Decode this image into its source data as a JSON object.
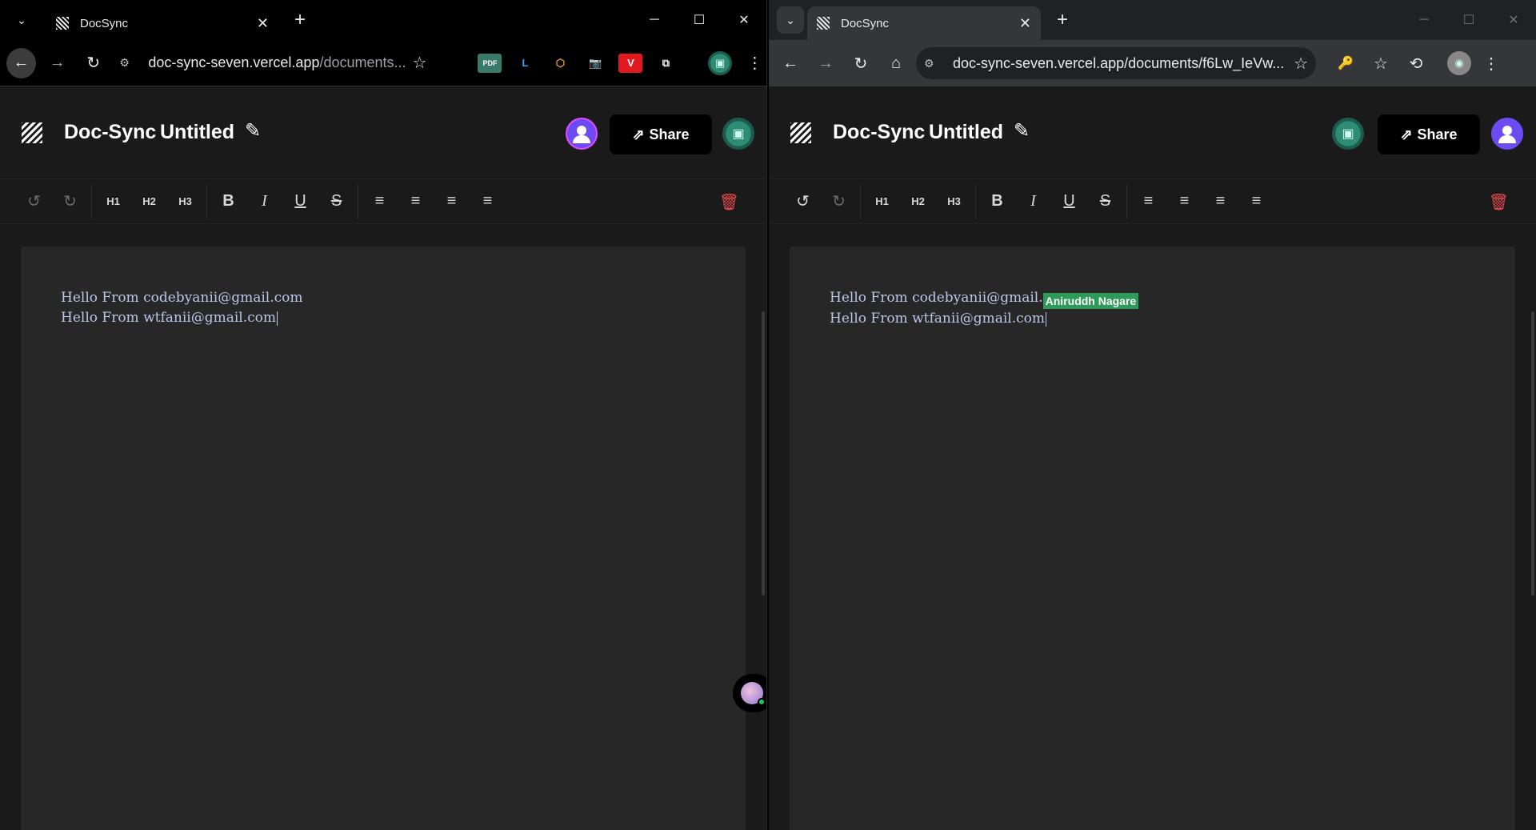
{
  "left_window": {
    "tab": {
      "title": "DocSync",
      "close": "✕"
    },
    "new_tab": "+",
    "controls": {
      "minimize": "─",
      "maximize": "☐",
      "close": "✕"
    },
    "nav": {
      "back": "←",
      "forward": "→",
      "reload": "↻"
    },
    "omnibox": {
      "host": "doc-sync-seven.vercel.app",
      "path": "/documents..."
    },
    "extensions": [
      {
        "name": "pdf-extension-icon",
        "text": "PDF",
        "bg": "#3a7a6a",
        "fg": "#ffffff"
      },
      {
        "name": "l-extension-icon",
        "text": "L",
        "bg": "transparent",
        "fg": "#2aa7ff"
      },
      {
        "name": "code-extension-icon",
        "text": "⬡",
        "bg": "transparent",
        "fg": "#f0a030"
      },
      {
        "name": "camera-extension-icon",
        "text": "📷",
        "bg": "transparent",
        "fg": "#dddddd"
      },
      {
        "name": "v-extension-icon",
        "text": "V",
        "bg": "#e0191e",
        "fg": "#ffffff"
      },
      {
        "name": "puzzle-extension-icon",
        "text": "⧉",
        "bg": "transparent",
        "fg": "#e8eaed"
      }
    ]
  },
  "right_window": {
    "tab": {
      "title": "DocSync",
      "close": "✕"
    },
    "new_tab": "+",
    "controls": {
      "minimize": "─",
      "maximize": "☐",
      "close": "✕"
    },
    "nav": {
      "back": "←",
      "forward": "→",
      "reload": "↻",
      "home": "⌂"
    },
    "omnibox": {
      "host": "doc-sync-seven.vercel.app/documents/f6Lw_IeVw...",
      "path": ""
    },
    "toolbar_icons": [
      "🔑",
      "☆",
      "⟲"
    ]
  },
  "app": {
    "brand": "Doc-Sync",
    "doc_title": "Untitled",
    "edit_icon": "✎",
    "share_label": "Share",
    "share_icon": "⇗",
    "toolbar": {
      "undo": "↺",
      "redo": "↻",
      "h1": "H1",
      "h2": "H2",
      "h3": "H3",
      "bold": "B",
      "italic": "I",
      "underline": "U",
      "strike": "S",
      "align_left": "≡",
      "align_center": "≡",
      "align_right": "≡",
      "justify": "≡",
      "trash": "🗑"
    }
  },
  "document": {
    "line1": "Hello From codebyanii@gmail.com",
    "line1_partial": "Hello From codebyanii@gmail.",
    "line2": "Hello From wtfanii@gmail.com",
    "collaborator_label": "Aniruddh Nagare"
  },
  "colors": {
    "accent_purple": "#6d4bf2",
    "collab_green": "#2e9a5a",
    "trash_red": "#e5484d",
    "online_green": "#22c55e"
  }
}
